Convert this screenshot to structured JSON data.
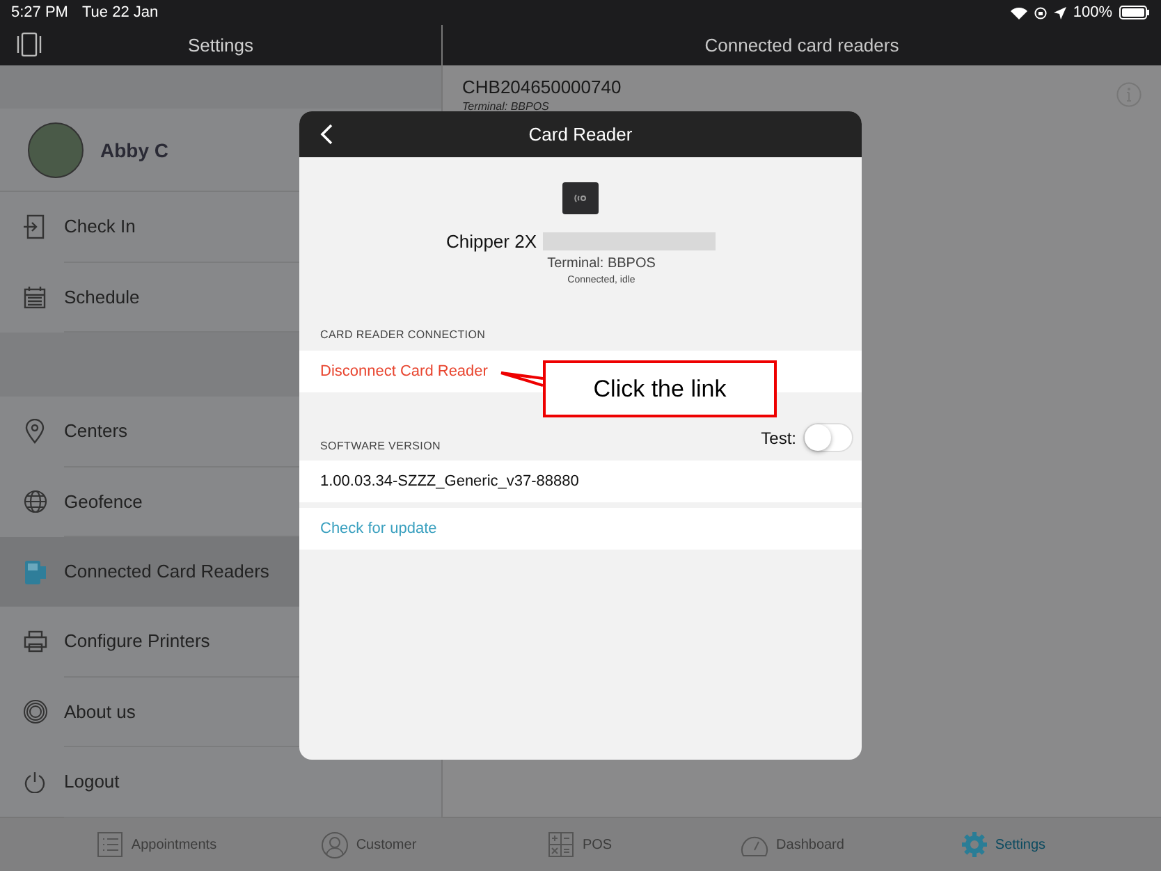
{
  "status_bar": {
    "time": "5:27 PM",
    "date": "Tue 22 Jan",
    "battery": "100%"
  },
  "sidebar": {
    "title": "Settings",
    "user": "Abby C",
    "groups": [
      [
        {
          "label": "Check In",
          "selected": false
        },
        {
          "label": "Schedule",
          "selected": false
        }
      ],
      [
        {
          "label": "Centers",
          "selected": false
        },
        {
          "label": "Geofence",
          "selected": false
        },
        {
          "label": "Connected Card Readers",
          "selected": true
        },
        {
          "label": "Configure Printers",
          "selected": false
        },
        {
          "label": "About us",
          "selected": false
        },
        {
          "label": "Logout",
          "selected": false
        }
      ]
    ]
  },
  "detail": {
    "title": "Connected card readers",
    "reader_id": "CHB204650000740",
    "reader_terminal": "Terminal: BBPOS"
  },
  "modal": {
    "title": "Card Reader",
    "device_name": "Chipper 2X",
    "terminal": "Terminal: BBPOS",
    "status": "Connected, idle",
    "connection_header": "CARD READER CONNECTION",
    "disconnect_link": "Disconnect Card Reader",
    "software_header": "SOFTWARE VERSION",
    "test_label": "Test:",
    "test_on": false,
    "version": "1.00.03.34-SZZZ_Generic_v37-88880",
    "update_link": "Check for update"
  },
  "callout": {
    "text": "Click the link"
  },
  "tab_bar": [
    {
      "label": "Appointments",
      "selected": false
    },
    {
      "label": "Customer",
      "selected": false
    },
    {
      "label": "POS",
      "selected": false
    },
    {
      "label": "Dashboard",
      "selected": false
    },
    {
      "label": "Settings",
      "selected": true
    }
  ]
}
